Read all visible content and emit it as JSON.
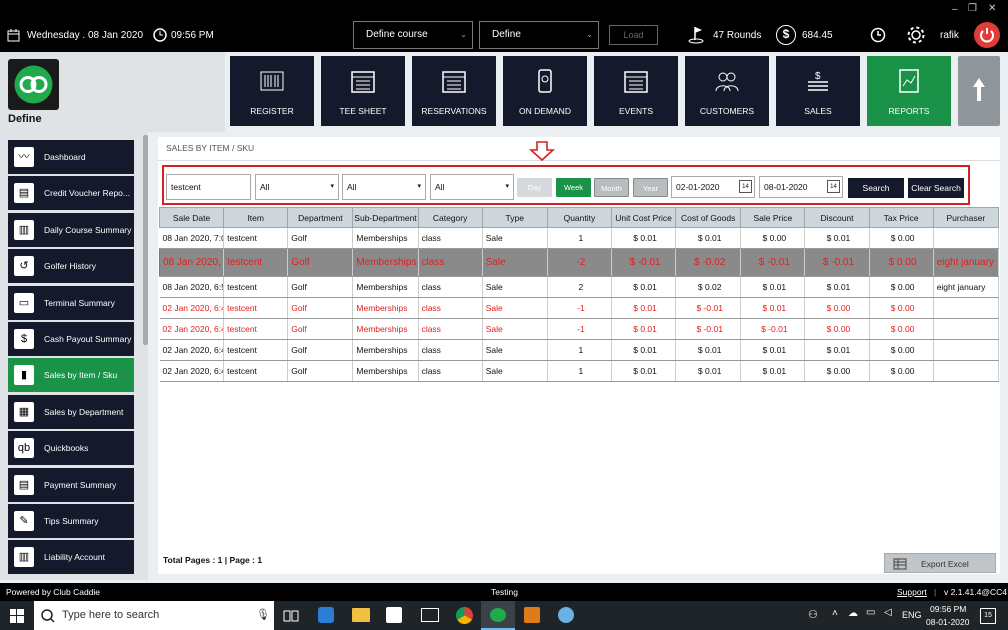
{
  "window": {
    "minimize": "–",
    "restore": "❐",
    "close": "✕"
  },
  "topbar": {
    "date": "Wednesday . 08 Jan 2020",
    "time": "09:56 PM",
    "course_select": "Define  course",
    "define_select": "Define",
    "load_label": "Load",
    "rounds": "47 Rounds",
    "balance": "684.45",
    "user": "rafik"
  },
  "brand": {
    "name": "Define"
  },
  "tiles": [
    {
      "label": "REGISTER",
      "active": false
    },
    {
      "label": "TEE SHEET",
      "active": false
    },
    {
      "label": "RESERVATIONS",
      "active": false
    },
    {
      "label": "ON DEMAND",
      "active": false
    },
    {
      "label": "EVENTS",
      "active": false
    },
    {
      "label": "CUSTOMERS",
      "active": false
    },
    {
      "label": "SALES",
      "active": false
    },
    {
      "label": "REPORTS",
      "active": true
    }
  ],
  "sidebar": {
    "items": [
      {
        "label": "Dashboard",
        "icon": "chart-line-icon"
      },
      {
        "label": "Credit Voucher Repo...",
        "icon": "document-icon"
      },
      {
        "label": "Daily Course Summary",
        "icon": "clipboard-icon"
      },
      {
        "label": "Golfer History",
        "icon": "history-icon"
      },
      {
        "label": "Terminal Summary",
        "icon": "monitor-icon"
      },
      {
        "label": "Cash Payout Summary",
        "icon": "cash-icon"
      },
      {
        "label": "Sales by Item / Sku",
        "icon": "bar-chart-icon"
      },
      {
        "label": "Sales by Department",
        "icon": "calendar-icon"
      },
      {
        "label": "Quickbooks",
        "icon": "quickbooks-icon"
      },
      {
        "label": "Payment Summary",
        "icon": "receipt-icon"
      },
      {
        "label": "Tips Summary",
        "icon": "tips-icon"
      },
      {
        "label": "Liability Account",
        "icon": "ledger-icon"
      }
    ]
  },
  "report": {
    "breadcrumb": "SALES BY ITEM / SKU"
  },
  "filters": {
    "search_value": "testcent",
    "department": "All",
    "subdepartment": "All",
    "category": "All",
    "day": "Day",
    "week": "Week",
    "month": "Month",
    "year": "Year",
    "from_date": "02-01-2020",
    "to_date": "08-01-2020",
    "search_btn": "Search",
    "clear_btn": "Clear Search",
    "cal": "14"
  },
  "table": {
    "headers": [
      "Sale Date",
      "Item",
      "Department",
      "Sub-Department",
      "Category",
      "Type",
      "Quantity",
      "Unit Cost Price",
      "Cost of Goods",
      "Sale Price",
      "Discount",
      "Tax Price",
      "Purchaser"
    ],
    "rows": [
      {
        "c": [
          "08 Jan 2020, 7:0",
          "testcent",
          "Golf",
          "Memberships",
          "class",
          "Sale",
          "1",
          "$ 0.01",
          "$ 0.01",
          "$ 0.00",
          "$ 0.01",
          "$ 0.00",
          ""
        ],
        "neg": false,
        "sel": false
      },
      {
        "c": [
          "08 Jan 2020, 6:5",
          "testcent",
          "Golf",
          "Memberships",
          "class",
          "Sale",
          "-2",
          "$ -0.01",
          "$ -0.02",
          "$ -0.01",
          "$ -0.01",
          "$ 0.00",
          "eight january"
        ],
        "neg": true,
        "sel": true
      },
      {
        "c": [
          "08 Jan 2020, 6:5",
          "testcent",
          "Golf",
          "Memberships",
          "class",
          "Sale",
          "2",
          "$ 0.01",
          "$ 0.02",
          "$ 0.01",
          "$ 0.01",
          "$ 0.00",
          "eight january"
        ],
        "neg": false,
        "sel": false
      },
      {
        "c": [
          "02 Jan 2020, 6:4",
          "testcent",
          "Golf",
          "Memberships",
          "class",
          "Sale",
          "-1",
          "$ 0.01",
          "$ -0.01",
          "$ 0.01",
          "$ 0.00",
          "$ 0.00",
          ""
        ],
        "neg": true,
        "sel": false
      },
      {
        "c": [
          "02 Jan 2020, 6:4",
          "testcent",
          "Golf",
          "Memberships",
          "class",
          "Sale",
          "-1",
          "$ 0.01",
          "$ -0.01",
          "$ -0.01",
          "$ 0.00",
          "$ 0.00",
          ""
        ],
        "neg": true,
        "sel": false
      },
      {
        "c": [
          "02 Jan 2020, 6:4",
          "testcent",
          "Golf",
          "Memberships",
          "class",
          "Sale",
          "1",
          "$ 0.01",
          "$ 0.01",
          "$ 0.01",
          "$ 0.01",
          "$ 0.00",
          ""
        ],
        "neg": false,
        "sel": false
      },
      {
        "c": [
          "02 Jan 2020, 6:4",
          "testcent",
          "Golf",
          "Memberships",
          "class",
          "Sale",
          "1",
          "$ 0.01",
          "$ 0.01",
          "$ 0.01",
          "$ 0.00",
          "$ 0.00",
          ""
        ],
        "neg": false,
        "sel": false
      }
    ]
  },
  "pagination": {
    "text": "Total Pages : 1 | Page : 1"
  },
  "export_label": "Export Excel",
  "footer": {
    "powered": "Powered by Club Caddie",
    "status": "Testing",
    "support": "Support",
    "version": "v 2.1.41.4@CC4"
  },
  "taskbar": {
    "search_placeholder": "Type here to search",
    "lang": "ENG",
    "time": "09:56 PM",
    "date": "08-01-2020",
    "notif": "15"
  },
  "colors": {
    "accent_green": "#1a9248",
    "tile_bg": "#14192b",
    "highlight_red": "#d32222",
    "negative_text": "#e02020"
  }
}
